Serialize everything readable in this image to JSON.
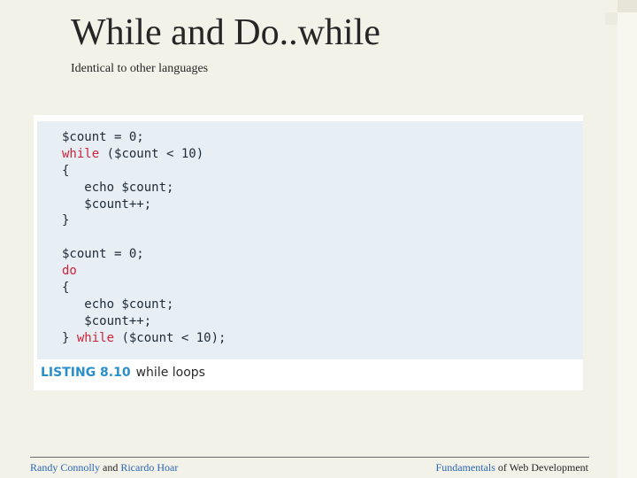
{
  "slide": {
    "title": "While and Do..while",
    "subtitle": "Identical to other languages"
  },
  "listing": {
    "lines": [
      [
        {
          "t": "$count = 0;",
          "kw": false
        }
      ],
      [
        {
          "t": "while",
          "kw": true
        },
        {
          "t": " ($count < 10)",
          "kw": false
        }
      ],
      [
        {
          "t": "{",
          "kw": false
        }
      ],
      [
        {
          "t": "   echo $count;",
          "kw": false
        }
      ],
      [
        {
          "t": "   $count++;",
          "kw": false
        }
      ],
      [
        {
          "t": "}",
          "kw": false
        }
      ],
      [
        {
          "t": "",
          "kw": false
        }
      ],
      [
        {
          "t": "$count = 0;",
          "kw": false
        }
      ],
      [
        {
          "t": "do",
          "kw": true
        }
      ],
      [
        {
          "t": "{",
          "kw": false
        }
      ],
      [
        {
          "t": "   echo $count;",
          "kw": false
        }
      ],
      [
        {
          "t": "   $count++;",
          "kw": false
        }
      ],
      [
        {
          "t": "} ",
          "kw": false
        },
        {
          "t": "while",
          "kw": true
        },
        {
          "t": " ($count < 10);",
          "kw": false
        }
      ]
    ],
    "caption_label": "LISTING 8.10",
    "caption_text": "while loops"
  },
  "footer": {
    "authors_first": "Randy Connolly",
    "authors_and": " and ",
    "authors_second": "Ricardo Hoar",
    "book_first": "Fundamentals",
    "book_rest": " of Web Development"
  },
  "colors": {
    "background": "#f3f2e8",
    "code_background": "#e7eff5",
    "keyword": "#d0233a",
    "caption_label": "#2a8fc9",
    "footer_link": "#2a64b8"
  }
}
